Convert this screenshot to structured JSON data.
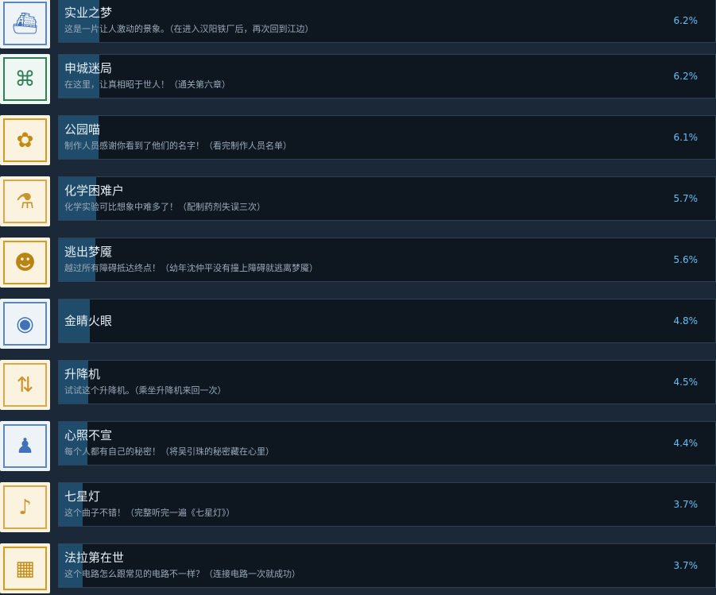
{
  "achievements": [
    {
      "name": "实业之梦",
      "desc": "这是一片让人激动的景象。（在进入汉阳铁厂后，再次回到江边）",
      "percent": "6.2%",
      "percent_value": 6.2,
      "icon": "factory-river-icon",
      "icon_colors": {
        "bg": "#eef3f8",
        "frame": "#5b87c3",
        "glyph": "#3f72b8"
      }
    },
    {
      "name": "申城迷局",
      "desc": "在这里，让真相昭于世人！（通关第六章）",
      "percent": "6.2%",
      "percent_value": 6.2,
      "icon": "city-puzzle-icon",
      "icon_colors": {
        "bg": "#eef7f1",
        "frame": "#2f7f5a",
        "glyph": "#2f7f5a"
      }
    },
    {
      "name": "公园喵",
      "desc": "制作人员感谢你看到了他们的名字！（看完制作人员名单）",
      "percent": "6.1%",
      "percent_value": 6.1,
      "icon": "cat-face-icon",
      "icon_colors": {
        "bg": "#fbf3df",
        "frame": "#d29b22",
        "glyph": "#c68a12"
      }
    },
    {
      "name": "化学困难户",
      "desc": "化学实验可比想象中难多了！（配制药剂失误三次）",
      "percent": "5.7%",
      "percent_value": 5.7,
      "icon": "flask-icon",
      "icon_colors": {
        "bg": "#fbf3df",
        "frame": "#d6a94a",
        "glyph": "#c9952a"
      }
    },
    {
      "name": "逃出梦魇",
      "desc": "越过所有障碍抵达终点！（幼年沈仲平没有撞上障碍就逃离梦魇）",
      "percent": "5.6%",
      "percent_value": 5.6,
      "icon": "mask-icon",
      "icon_colors": {
        "bg": "#fbf3df",
        "frame": "#d29b22",
        "glyph": "#b98412"
      }
    },
    {
      "name": "金睛火眼",
      "desc": "",
      "percent": "4.8%",
      "percent_value": 4.8,
      "icon": "detective-eye-icon",
      "icon_colors": {
        "bg": "#eef3f8",
        "frame": "#5b87c3",
        "glyph": "#3f72b8"
      }
    },
    {
      "name": "升降机",
      "desc": "试试这个升降机。（乘坐升降机来回一次）",
      "percent": "4.5%",
      "percent_value": 4.5,
      "icon": "elevator-icon",
      "icon_colors": {
        "bg": "#fbf3df",
        "frame": "#d6a94a",
        "glyph": "#c9952a"
      }
    },
    {
      "name": "心照不宣",
      "desc": "每个人都有自己的秘密！（将吴引珠的秘密藏在心里）",
      "percent": "4.4%",
      "percent_value": 4.4,
      "icon": "secret-figure-icon",
      "icon_colors": {
        "bg": "#eef3f8",
        "frame": "#5b87c3",
        "glyph": "#3f72b8"
      }
    },
    {
      "name": "七星灯",
      "desc": "这个曲子不错！（完整听完一遍《七星灯》）",
      "percent": "3.7%",
      "percent_value": 3.7,
      "icon": "gramophone-icon",
      "icon_colors": {
        "bg": "#fbf3df",
        "frame": "#d6a94a",
        "glyph": "#c9952a"
      }
    },
    {
      "name": "法拉第在世",
      "desc": "这个电路怎么跟常见的电路不一样？（连接电路一次就成功）",
      "percent": "3.7%",
      "percent_value": 3.7,
      "icon": "circuit-icon",
      "icon_colors": {
        "bg": "#fbf3df",
        "frame": "#d29b22",
        "glyph": "#c68a12"
      }
    }
  ],
  "colors": {
    "page_bg": "#1b2838",
    "panel_bg": "#0e1720",
    "progress_bar": "#1f4c6b",
    "title_text": "#e6eef5",
    "desc_text": "#9aa9b8",
    "percent_text": "#66c0f4"
  }
}
